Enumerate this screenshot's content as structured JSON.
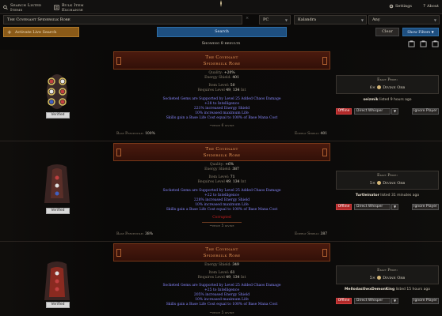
{
  "nav": {
    "search_listed_items": "Search Listed Items",
    "bulk_item_exchange": "Bulk Item Exchange",
    "settings": "Settings",
    "about": "About"
  },
  "filters": {
    "item_query": "The Covenant Spidersilk Robe",
    "platform": "PC",
    "league": "Kalandra",
    "status": "Any"
  },
  "actions": {
    "activate_live_search": "Activate Live Search",
    "search": "Search",
    "clear": "Clear",
    "show_filters": "Show Filters"
  },
  "results": {
    "count_text": "Showing 8 results"
  },
  "listings": [
    {
      "name": "The Covenant",
      "base": "Spidersilk Robe",
      "quality": "+20%",
      "energy_shield": "401",
      "item_level": "50",
      "req_level": "49",
      "req_int": "134",
      "mods": [
        "Socketed Gems are Supported by Level 25 Added Chaos Damage",
        "+28 to Intelligence",
        "221% increased Energy Shield",
        "10% increased maximum Life",
        "Skills gain a Base Life Cost equal to 100% of Base Mana Cost"
      ],
      "price_note": "~price 6 divine",
      "base_percentile": "100%",
      "es_footer": "401",
      "verified": "Verified",
      "exact_price_label": "Exact Price:",
      "price_amount": "6×",
      "currency": "Divine Orb",
      "seller": "seizmik",
      "listed": "listed 9 hours ago"
    },
    {
      "name": "The Covenant",
      "base": "Spidersilk Robe",
      "quality": "+6%",
      "energy_shield": "387",
      "item_level": "71",
      "req_level": "49",
      "req_int": "134",
      "mods": [
        "Socketed Gems are Supported by Level 25 Added Chaos Damage",
        "+22 to Intelligence",
        "228% increased Energy Shield",
        "10% increased maximum Life",
        "Skills gain a Base Life Cost equal to 100% of Base Mana Cost"
      ],
      "corrupted": "Corrupted",
      "price_note": "~price 5 divine",
      "base_percentile": "38%",
      "es_footer": "387",
      "verified": "Verified",
      "exact_price_label": "Exact Price:",
      "price_amount": "5×",
      "currency": "Divine Orb",
      "seller": "Turtleinator",
      "listed": "listed 31 minutes ago"
    },
    {
      "name": "The Covenant",
      "base": "Spidersilk Robe",
      "energy_shield": "349",
      "item_level": "61",
      "req_level": "49",
      "req_int": "134",
      "mods": [
        "Socketed Gems are Supported by Level 25 Added Chaos Damage",
        "+25 to Intelligence",
        "205% increased Energy Shield",
        "10% increased maximum Life",
        "Skills gain a Base Life Cost equal to 100% of Base Mana Cost"
      ],
      "price_note": "~price 5 divine",
      "verified": "Verified",
      "exact_price_label": "Exact Price:",
      "price_amount": "5×",
      "currency": "Divine Orb",
      "seller": "MellodasthexDemonKing",
      "listed": "listed 15 hours ago"
    }
  ],
  "labels": {
    "quality": "Quality:",
    "energy_shield": "Energy Shield:",
    "item_level": "Item Level:",
    "requires": "Requires Level",
    "int": "Int",
    "base_percentile": "Base Percentile:",
    "es_footer": "Energy Shield:",
    "offline": "Offline",
    "direct_whisper": "Direct Whisper",
    "ignore_player": "Ignore Player"
  },
  "colors": {
    "accent_orange": "#8a5a18",
    "search_blue": "#1e4f80",
    "unique_name": "#e89a5a",
    "mod_blue": "#8888ff",
    "corrupted_red": "#d02020",
    "offline_red": "#b02828"
  }
}
